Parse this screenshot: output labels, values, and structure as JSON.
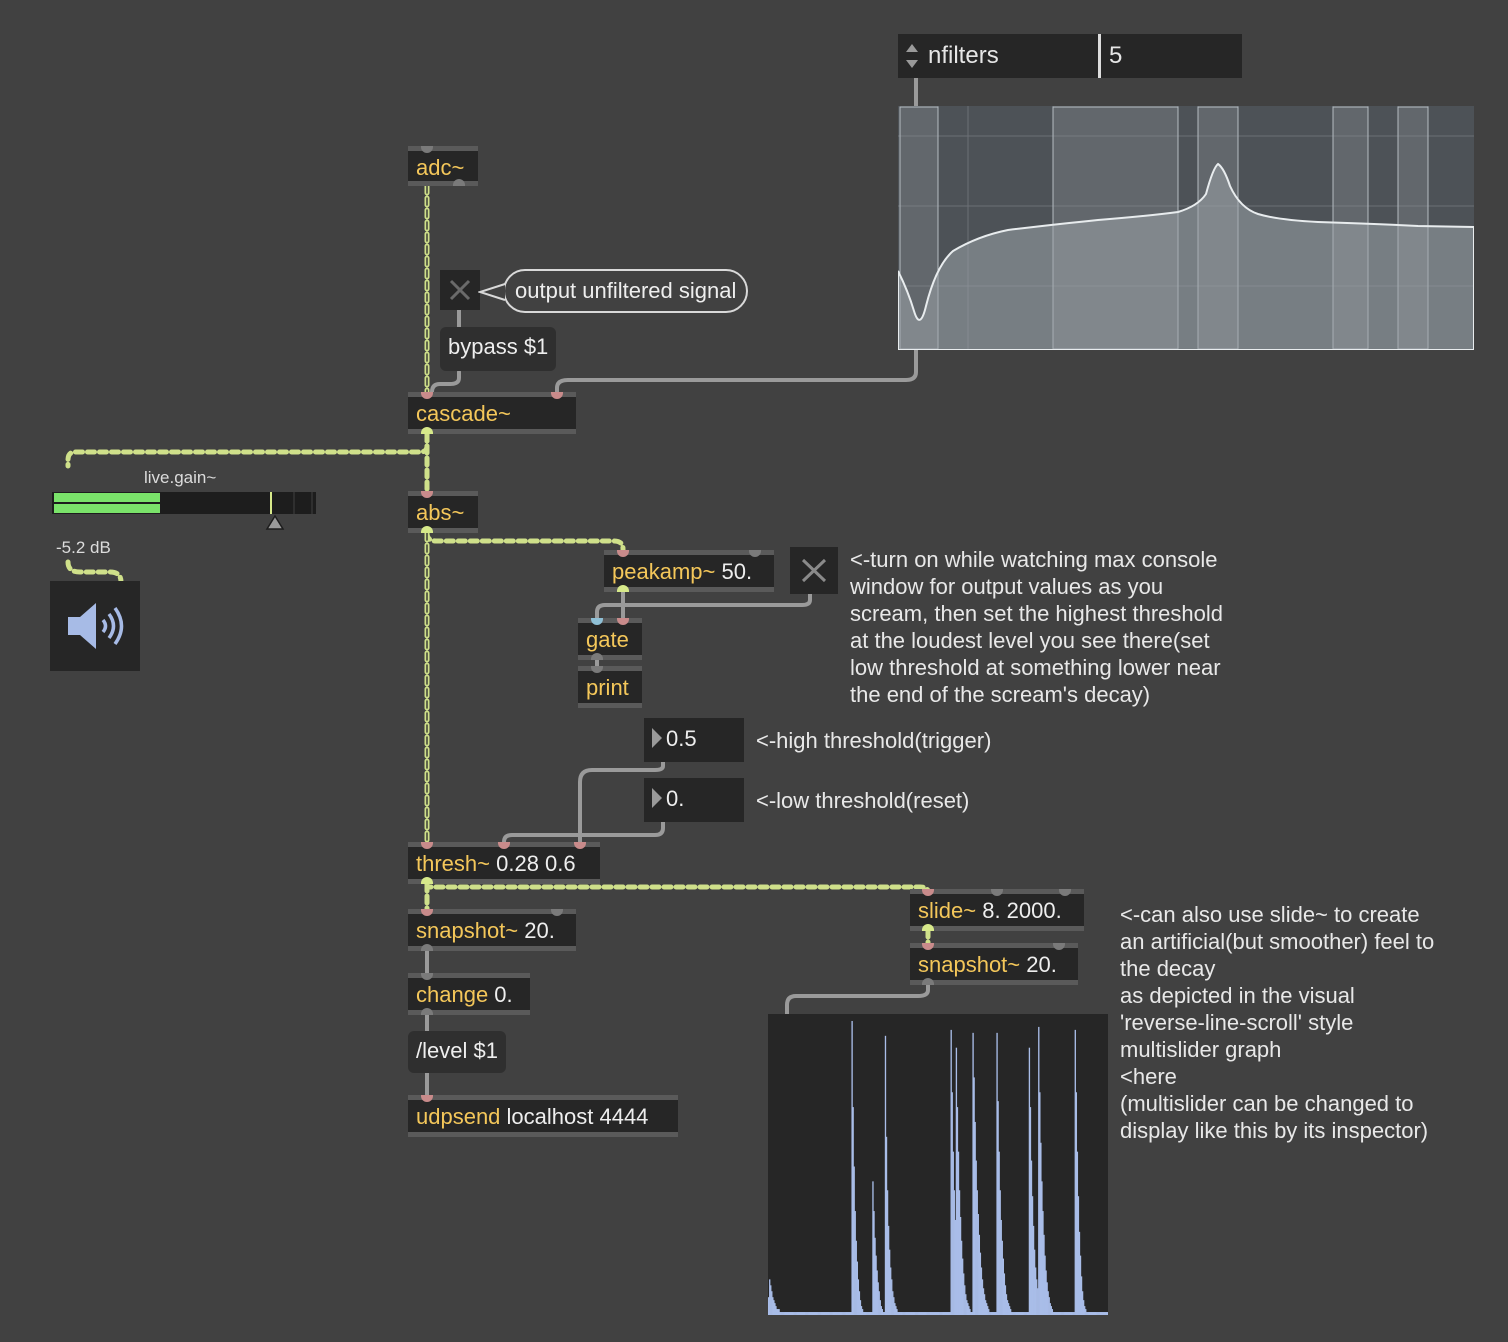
{
  "objects": {
    "adc": {
      "cls": "adc~",
      "args": ""
    },
    "cascade": {
      "cls": "cascade~",
      "args": ""
    },
    "abs": {
      "cls": "abs~",
      "args": ""
    },
    "peakamp": {
      "cls": "peakamp~",
      "args": " 50."
    },
    "gate": {
      "cls": "gate",
      "args": ""
    },
    "print": {
      "cls": "print",
      "args": ""
    },
    "thresh": {
      "cls": "thresh~",
      "args": " 0.28 0.6"
    },
    "snapshot1": {
      "cls": "snapshot~",
      "args": " 20."
    },
    "change": {
      "cls": "change",
      "args": " 0."
    },
    "udpsend": {
      "cls": "udpsend",
      "args": " localhost 4444"
    },
    "slide": {
      "cls": "slide~",
      "args": " 8. 2000."
    },
    "snapshot2": {
      "cls": "snapshot~",
      "args": " 20."
    }
  },
  "messages": {
    "bypass": "bypass $1",
    "level": "/level $1"
  },
  "numbers": {
    "high_threshold": "0.5",
    "low_threshold": "0.",
    "nfilters_value": "5"
  },
  "umenu": {
    "nfilters_label": "nfilters"
  },
  "bubble": {
    "text": "output unfiltered signal"
  },
  "comments": {
    "peakamp_note": "<-turn on while watching max console\nwindow for output values as you\nscream, then set the highest threshold\nat the loudest level you see there(set\nlow threshold at something lower near\nthe end of the scream's decay)",
    "high_note": "<-high threshold(trigger)",
    "low_note": "<-low threshold(reset)",
    "slide_note": "<-can also use slide~ to create\nan artificial(but smoother) feel to\nthe decay\nas depicted in the visual\n'reverse-line-scroll' style\nmultislider graph\n<here\n(multislider can be changed to\ndisplay like this by its inspector)"
  },
  "live_gain": {
    "label": "live.gain~",
    "value_text": "-5.2 dB",
    "level_fraction": 0.41,
    "gain_fraction": 0.83
  },
  "toggles": {
    "bypass_on": false,
    "print_on": false
  },
  "colors": {
    "background": "#414141",
    "object_class": "#f4c75a",
    "signal_cable": "#d7e98a",
    "meter_green": "#7ae36a",
    "multislider_bar": "#a9bde8",
    "speaker_icon": "#a7bbe6"
  },
  "multislider_values": [
    0.06,
    0.12,
    0.1,
    0.08,
    0.06,
    0.05,
    0.04,
    0.03,
    0.02,
    0.02,
    0.02,
    0.01,
    0.01,
    0.01,
    0.01,
    0.01,
    0.01,
    0.01,
    0.01,
    0.01,
    0.01,
    0.01,
    0.01,
    0.01,
    0.01,
    0.01,
    0.01,
    0.01,
    0.01,
    0.01,
    0.01,
    0.01,
    0.01,
    0.01,
    0.01,
    0.01,
    0.01,
    0.01,
    0.01,
    0.01,
    0.01,
    0.01,
    0.01,
    0.01,
    0.01,
    0.01,
    0.01,
    0.01,
    0.01,
    0.01,
    0.01,
    0.01,
    0.01,
    0.01,
    0.01,
    0.01,
    0.01,
    0.01,
    0.01,
    0.01,
    0.01,
    0.01,
    0.01,
    0.01,
    0.01,
    0.01,
    0.01,
    0.01,
    0.01,
    0.01,
    0.01,
    0.01,
    0.01,
    0.01,
    0.01,
    0.01,
    0.01,
    0.01,
    0.01,
    0.01,
    0.99,
    0.7,
    0.5,
    0.35,
    0.25,
    0.18,
    0.12,
    0.08,
    0.05,
    0.03,
    0.02,
    0.01,
    0.01,
    0.01,
    0.01,
    0.01,
    0.01,
    0.01,
    0.01,
    0.01,
    0.45,
    0.35,
    0.26,
    0.2,
    0.15,
    0.11,
    0.08,
    0.05,
    0.03,
    0.02,
    0.01,
    0.01,
    0.94,
    0.6,
    0.42,
    0.3,
    0.22,
    0.16,
    0.12,
    0.08,
    0.06,
    0.04,
    0.03,
    0.02,
    0.01,
    0.01,
    0.01,
    0.01,
    0.01,
    0.01,
    0.01,
    0.01,
    0.01,
    0.01,
    0.01,
    0.01,
    0.01,
    0.01,
    0.01,
    0.01,
    0.01,
    0.01,
    0.01,
    0.01,
    0.01,
    0.01,
    0.01,
    0.01,
    0.01,
    0.01,
    0.01,
    0.01,
    0.01,
    0.01,
    0.01,
    0.01,
    0.01,
    0.01,
    0.01,
    0.01,
    0.01,
    0.01,
    0.01,
    0.01,
    0.01,
    0.01,
    0.01,
    0.01,
    0.01,
    0.01,
    0.01,
    0.01,
    0.01,
    0.01,
    0.01,
    0.96,
    0.75,
    0.55,
    0.42,
    0.32,
    0.9,
    0.7,
    0.55,
    0.42,
    0.33,
    0.25,
    0.19,
    0.14,
    0.1,
    0.07,
    0.05,
    0.04,
    0.03,
    0.02,
    0.01,
    0.01,
    0.95,
    0.8,
    0.65,
    0.52,
    0.42,
    0.34,
    0.27,
    0.21,
    0.16,
    0.12,
    0.09,
    0.07,
    0.05,
    0.04,
    0.03,
    0.02,
    0.01,
    0.01,
    0.01,
    0.01,
    0.01,
    0.01,
    0.01,
    0.95,
    0.72,
    0.55,
    0.42,
    0.32,
    0.25,
    0.19,
    0.14,
    0.1,
    0.07,
    0.05,
    0.04,
    0.03,
    0.02,
    0.01,
    0.01,
    0.01,
    0.01,
    0.01,
    0.01,
    0.01,
    0.01,
    0.01,
    0.01,
    0.01,
    0.01,
    0.01,
    0.01,
    0.01,
    0.01,
    0.01,
    0.9,
    0.7,
    0.52,
    0.4,
    0.3,
    0.22,
    0.16,
    0.12,
    0.09,
    0.97,
    0.75,
    0.58,
    0.45,
    0.35,
    0.27,
    0.2,
    0.15,
    0.11,
    0.08,
    0.06,
    0.04,
    0.03,
    0.02,
    0.01,
    0.01,
    0.01,
    0.01,
    0.01,
    0.01,
    0.01,
    0.01,
    0.01,
    0.01,
    0.01,
    0.01,
    0.01,
    0.01,
    0.01,
    0.01,
    0.01,
    0.01,
    0.01,
    0.01,
    0.01,
    0.96,
    0.75,
    0.55,
    0.4,
    0.28,
    0.2,
    0.13,
    0.08,
    0.05,
    0.03,
    0.02,
    0.01,
    0.01,
    0.01,
    0.01,
    0.01,
    0.01,
    0.01,
    0.01,
    0.01,
    0.01,
    0.01,
    0.01,
    0.01,
    0.01,
    0.01,
    0.01,
    0.01,
    0.01,
    0.01,
    0.01,
    0.01
  ]
}
